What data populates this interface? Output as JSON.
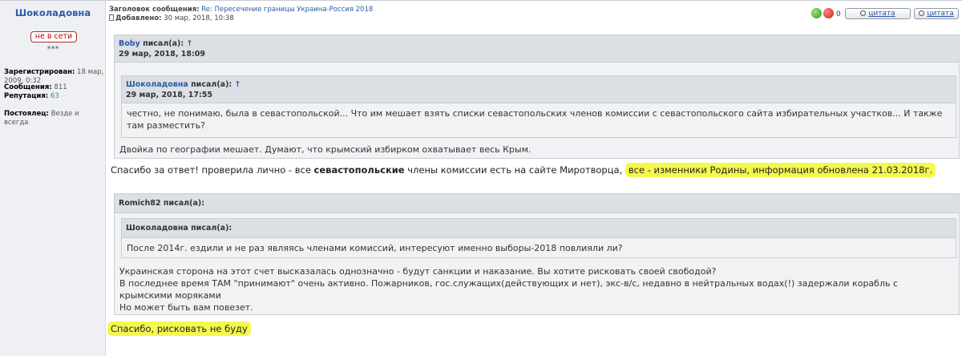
{
  "author": {
    "name": "Шоколадовна",
    "status": "не в сети",
    "rank": "***",
    "registered_label": "Зарегистрирован:",
    "registered_value": "18 мар, 2009, 0:32",
    "messages_label": "Сообщения:",
    "messages_value": "811",
    "reputation_label": "Репутация:",
    "reputation_value": "63",
    "resident_label": "Постоялец:",
    "resident_value": "Везде и всегда"
  },
  "header": {
    "subject_label": "Заголовок сообщения:",
    "subject": "Re: Пересечение границы Украина-Россия 2018",
    "added_label": "Добавлено:",
    "added_value": "30 мар, 2018, 10:38"
  },
  "actions": {
    "vote_count": "0",
    "quote_label": "цитата",
    "quote2_label": "цитата"
  },
  "quote1": {
    "author": "Boby",
    "wrote": "писал(а):",
    "arrow": "↑",
    "date": "29 мар, 2018, 18:09",
    "nested": {
      "author": "Шоколадовна",
      "wrote": "писал(а):",
      "arrow": "↑",
      "date": "29 мар, 2018, 17:55",
      "text": "честно, не понимаю, была в севастопольской... Что им мешает взять списки севастопольских членов комиссии с севастопольского сайта избирательных участков... И также там разместить?"
    },
    "text": "Двойка по географии мешает. Думают, что крымский избирком охватывает весь Крым."
  },
  "reply1": {
    "part1": "Спасибо за ответ! проверила лично - все",
    "bold": "севастопольские",
    "part2": "члены комиссии есть на сайте Миротворца,",
    "highlight": "все - изменники Родины, информация обновлена 21.03.2018г."
  },
  "quote2": {
    "header": "Romich82 писал(а):",
    "nested": {
      "header": "Шоколадовна писал(а):",
      "text": "После 2014г. ездили и не раз являясь членами комиссий, интересуют именно выборы-2018 повлияли ли?"
    },
    "lines": [
      "Украинская сторона на этот счет высказалась однозначно - будут санкции и наказание. Вы хотите рисковать своей свободой?",
      "В последнее время ТАМ \"принимают\" очень активно. Пожарников, гос.служащих(действующих и нет), экс-в/с, недавно в нейтральных водах(!) задержали корабль с крымскими моряками",
      "Но может быть вам повезет."
    ]
  },
  "reply2": {
    "text": "Спасибо, рисковать не буду"
  },
  "colors": {
    "link": "#2a5ba5",
    "highlight": "#f0f514",
    "status": "#cc0000"
  }
}
